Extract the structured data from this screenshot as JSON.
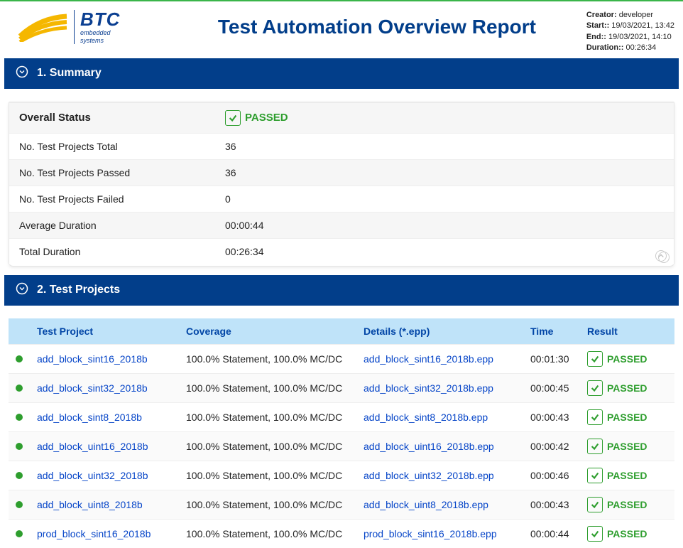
{
  "header": {
    "logo_main": "BTC",
    "logo_sub1": "embedded",
    "logo_sub2": "systems",
    "title": "Test Automation Overview Report",
    "meta": {
      "creator_label": "Creator:",
      "creator_value": "developer",
      "start_label": "Start::",
      "start_value": "19/03/2021, 13:42",
      "end_label": "End::",
      "end_value": "19/03/2021, 14:10",
      "duration_label": "Duration::",
      "duration_value": "00:26:34"
    }
  },
  "sections": {
    "summary_title": "1. Summary",
    "projects_title": "2. Test Projects"
  },
  "summary": {
    "rows": [
      {
        "label": "Overall Status",
        "value_type": "pass",
        "value": "PASSED"
      },
      {
        "label": "No. Test Projects Total",
        "value": "36"
      },
      {
        "label": "No. Test Projects Passed",
        "value": "36"
      },
      {
        "label": "No. Test Projects Failed",
        "value": "0"
      },
      {
        "label": "Average Duration",
        "value": "00:00:44"
      },
      {
        "label": "Total Duration",
        "value": "00:26:34"
      }
    ]
  },
  "projects": {
    "columns": {
      "name": "Test Project",
      "coverage": "Coverage",
      "details": "Details (*.epp)",
      "time": "Time",
      "result": "Result"
    },
    "rows": [
      {
        "name": "add_block_sint16_2018b",
        "coverage": "100.0% Statement, 100.0% MC/DC",
        "details": "add_block_sint16_2018b.epp",
        "time": "00:01:30",
        "result": "PASSED"
      },
      {
        "name": "add_block_sint32_2018b",
        "coverage": "100.0% Statement, 100.0% MC/DC",
        "details": "add_block_sint32_2018b.epp",
        "time": "00:00:45",
        "result": "PASSED"
      },
      {
        "name": "add_block_sint8_2018b",
        "coverage": "100.0% Statement, 100.0% MC/DC",
        "details": "add_block_sint8_2018b.epp",
        "time": "00:00:43",
        "result": "PASSED"
      },
      {
        "name": "add_block_uint16_2018b",
        "coverage": "100.0% Statement, 100.0% MC/DC",
        "details": "add_block_uint16_2018b.epp",
        "time": "00:00:42",
        "result": "PASSED"
      },
      {
        "name": "add_block_uint32_2018b",
        "coverage": "100.0% Statement, 100.0% MC/DC",
        "details": "add_block_uint32_2018b.epp",
        "time": "00:00:46",
        "result": "PASSED"
      },
      {
        "name": "add_block_uint8_2018b",
        "coverage": "100.0% Statement, 100.0% MC/DC",
        "details": "add_block_uint8_2018b.epp",
        "time": "00:00:43",
        "result": "PASSED"
      },
      {
        "name": "prod_block_sint16_2018b",
        "coverage": "100.0% Statement, 100.0% MC/DC",
        "details": "prod_block_sint16_2018b.epp",
        "time": "00:00:44",
        "result": "PASSED"
      }
    ]
  }
}
